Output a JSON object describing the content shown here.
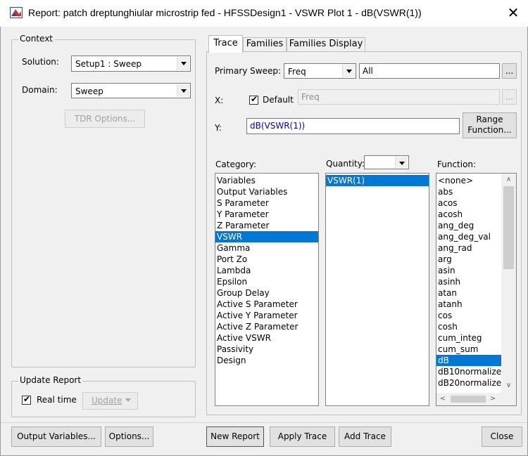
{
  "window": {
    "title": "Report: patch dreptunghiular microstrip fed - HFSSDesign1 - VSWR Plot 1 - dB(VSWR(1))",
    "close_glyph": "✕"
  },
  "context": {
    "legend": "Context",
    "solution_label": "Solution:",
    "solution_value": "Setup1 : Sweep",
    "domain_label": "Domain:",
    "domain_value": "Sweep",
    "tdr_button": "TDR Options..."
  },
  "update_report": {
    "legend": "Update Report",
    "realtime_label": "Real time",
    "realtime_checked": true,
    "update_button": "Update"
  },
  "tabs": [
    {
      "label": "Trace",
      "active": true
    },
    {
      "label": "Families",
      "active": false
    },
    {
      "label": "Families Display",
      "active": false
    }
  ],
  "trace": {
    "primary_sweep_label": "Primary Sweep:",
    "primary_sweep_value": "Freq",
    "primary_sweep_range": "All",
    "ellipsis": "...",
    "x_label": "X:",
    "x_default_label": "Default",
    "x_default_checked": true,
    "x_value": "Freq",
    "y_label": "Y:",
    "y_value": "dB(VSWR(1))",
    "range_function_line1": "Range",
    "range_function_line2": "Function..."
  },
  "category": {
    "label": "Category:",
    "items": [
      "Variables",
      "Output Variables",
      "S Parameter",
      "Y Parameter",
      "Z Parameter",
      "VSWR",
      "Gamma",
      "Port Zo",
      "Lambda",
      "Epsilon",
      "Group Delay",
      "Active S Parameter",
      "Active Y Parameter",
      "Active Z Parameter",
      "Active VSWR",
      "Passivity",
      "Design"
    ],
    "selected": "VSWR"
  },
  "quantity": {
    "label": "Quantity:",
    "filter_value": "",
    "items": [
      "VSWR(1)"
    ],
    "selected": "VSWR(1)"
  },
  "function": {
    "label": "Function:",
    "items": [
      "<none>",
      "abs",
      "acos",
      "acosh",
      "ang_deg",
      "ang_deg_val",
      "ang_rad",
      "arg",
      "asin",
      "asinh",
      "atan",
      "atanh",
      "cos",
      "cosh",
      "cum_integ",
      "cum_sum",
      "dB",
      "dB10normalize",
      "dB20normalize"
    ],
    "selected": "dB"
  },
  "bottom_buttons": {
    "output_variables": "Output Variables...",
    "options": "Options...",
    "new_report": "New Report",
    "apply_trace": "Apply Trace",
    "add_trace": "Add Trace",
    "close": "Close"
  },
  "colors": {
    "selection": "#0078d7",
    "y_expression": "#0000cc"
  }
}
